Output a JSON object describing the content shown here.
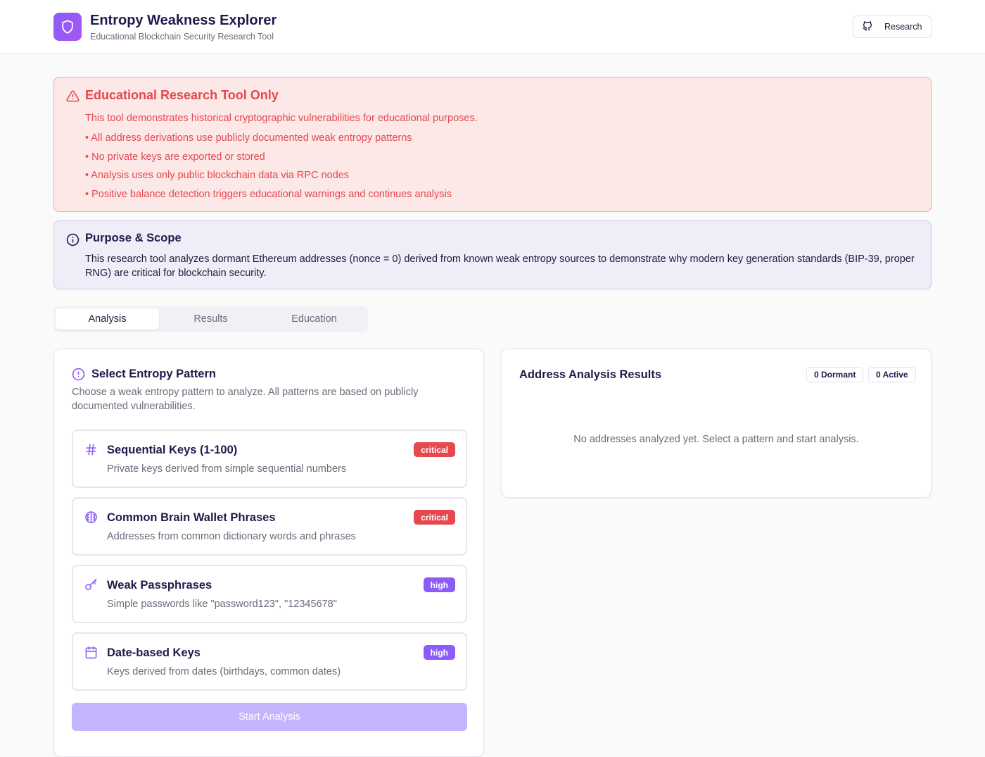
{
  "header": {
    "title": "Entropy Weakness Explorer",
    "subtitle": "Educational Blockchain Security Research Tool",
    "research_label": "Research"
  },
  "warning": {
    "title": "Educational Research Tool Only",
    "intro": "This tool demonstrates historical cryptographic vulnerabilities for educational purposes.",
    "items": [
      "• All address derivations use publicly documented weak entropy patterns",
      "• No private keys are exported or stored",
      "• Analysis uses only public blockchain data via RPC nodes",
      "• Positive balance detection triggers educational warnings and continues analysis"
    ]
  },
  "info": {
    "title": "Purpose & Scope",
    "text": "This research tool analyzes dormant Ethereum addresses (nonce = 0) derived from known weak entropy sources to demonstrate why modern key generation standards (BIP-39, proper RNG) are critical for blockchain security."
  },
  "tabs": [
    {
      "label": "Analysis",
      "active": true
    },
    {
      "label": "Results",
      "active": false
    },
    {
      "label": "Education",
      "active": false
    }
  ],
  "select_panel": {
    "title": "Select Entropy Pattern",
    "description": "Choose a weak entropy pattern to analyze. All patterns are based on publicly documented vulnerabilities.",
    "patterns": [
      {
        "icon": "hash-icon",
        "title": "Sequential Keys (1-100)",
        "description": "Private keys derived from simple sequential numbers",
        "severity": "critical"
      },
      {
        "icon": "brain-icon",
        "title": "Common Brain Wallet Phrases",
        "description": "Addresses from common dictionary words and phrases",
        "severity": "critical"
      },
      {
        "icon": "key-icon",
        "title": "Weak Passphrases",
        "description": "Simple passwords like \"password123\", \"12345678\"",
        "severity": "high"
      },
      {
        "icon": "calendar-icon",
        "title": "Date-based Keys",
        "description": "Keys derived from dates (birthdays, common dates)",
        "severity": "high"
      }
    ],
    "start_label": "Start Analysis"
  },
  "results_panel": {
    "title": "Address Analysis Results",
    "dormant_label": "0 Dormant",
    "active_label": "0 Active",
    "empty_message": "No addresses analyzed yet. Select a pattern and start analysis."
  },
  "colors": {
    "accent": "#8b5cf6",
    "critical": "#e5484d",
    "high": "#8b5cf6",
    "warning_bg": "#fce8e6",
    "info_bg": "#eeedf8"
  }
}
